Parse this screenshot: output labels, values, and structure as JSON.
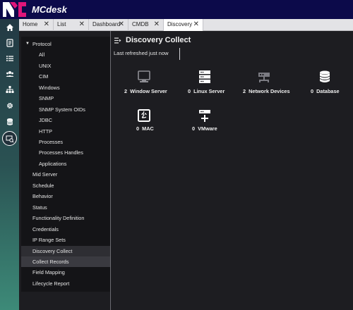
{
  "app": {
    "brand": "MCdesk",
    "logo_text": "MC"
  },
  "tabs": [
    {
      "label": "Home",
      "close": "✕"
    },
    {
      "label": "List",
      "close": "✕"
    },
    {
      "label": "Dashboard",
      "close": "✕"
    },
    {
      "label": "CMDB",
      "close": "✕"
    },
    {
      "label": "Discovery",
      "close": "✕"
    }
  ],
  "rail": [
    "home-icon",
    "tasks-icon",
    "list-icon",
    "users-icon",
    "hierarchy-icon",
    "gear-icon",
    "database-icon",
    "discovery-icon"
  ],
  "sidebar": {
    "group": {
      "label": "Protocol",
      "caret": "▼"
    },
    "subitems": [
      "All",
      "UNIX",
      "CIM",
      "Windows",
      "SNMP",
      "SNMP System OIDs",
      "JDBC",
      "HTTP",
      "Processes",
      "Processes Handles",
      "Applications"
    ],
    "items": [
      "Mid Server",
      "Schedule",
      "Behavior",
      "Status",
      "Functionality Definition",
      "Credentials",
      "IP Range Sets",
      "Discovery Collect",
      "Collect Records",
      "Field Mapping",
      "Lifecycle Report"
    ]
  },
  "main": {
    "title": "Discovery Collect",
    "refresh_text": "Last refreshed just now",
    "cards": [
      {
        "count": "2",
        "label": "Window Server",
        "icon": "monitor-icon"
      },
      {
        "count": "0",
        "label": "Linux Server",
        "icon": "server-icon"
      },
      {
        "count": "2",
        "label": "Network Devices",
        "icon": "network-device-icon"
      },
      {
        "count": "0",
        "label": "Database",
        "icon": "database-icon"
      },
      {
        "count": "0",
        "label": "MAC",
        "icon": "mac-icon"
      },
      {
        "count": "0",
        "label": "VMware",
        "icon": "vmware-icon"
      }
    ]
  },
  "colors": {
    "topbar": "#0c0a4a",
    "accent_pink": "#e0157a",
    "background": "#1d1d21",
    "sidebar": "#141417"
  }
}
